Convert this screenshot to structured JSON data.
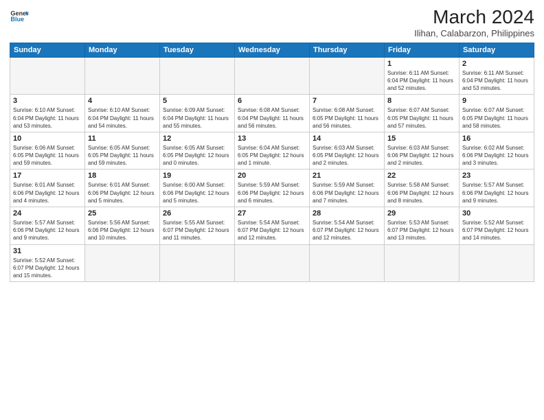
{
  "header": {
    "logo_line1": "General",
    "logo_line2": "Blue",
    "title": "March 2024",
    "subtitle": "Ilihan, Calabarzon, Philippines"
  },
  "weekdays": [
    "Sunday",
    "Monday",
    "Tuesday",
    "Wednesday",
    "Thursday",
    "Friday",
    "Saturday"
  ],
  "weeks": [
    [
      {
        "day": "",
        "info": ""
      },
      {
        "day": "",
        "info": ""
      },
      {
        "day": "",
        "info": ""
      },
      {
        "day": "",
        "info": ""
      },
      {
        "day": "",
        "info": ""
      },
      {
        "day": "1",
        "info": "Sunrise: 6:11 AM\nSunset: 6:04 PM\nDaylight: 11 hours\nand 52 minutes."
      },
      {
        "day": "2",
        "info": "Sunrise: 6:11 AM\nSunset: 6:04 PM\nDaylight: 11 hours\nand 53 minutes."
      }
    ],
    [
      {
        "day": "3",
        "info": "Sunrise: 6:10 AM\nSunset: 6:04 PM\nDaylight: 11 hours\nand 53 minutes."
      },
      {
        "day": "4",
        "info": "Sunrise: 6:10 AM\nSunset: 6:04 PM\nDaylight: 11 hours\nand 54 minutes."
      },
      {
        "day": "5",
        "info": "Sunrise: 6:09 AM\nSunset: 6:04 PM\nDaylight: 11 hours\nand 55 minutes."
      },
      {
        "day": "6",
        "info": "Sunrise: 6:08 AM\nSunset: 6:04 PM\nDaylight: 11 hours\nand 56 minutes."
      },
      {
        "day": "7",
        "info": "Sunrise: 6:08 AM\nSunset: 6:05 PM\nDaylight: 11 hours\nand 56 minutes."
      },
      {
        "day": "8",
        "info": "Sunrise: 6:07 AM\nSunset: 6:05 PM\nDaylight: 11 hours\nand 57 minutes."
      },
      {
        "day": "9",
        "info": "Sunrise: 6:07 AM\nSunset: 6:05 PM\nDaylight: 11 hours\nand 58 minutes."
      }
    ],
    [
      {
        "day": "10",
        "info": "Sunrise: 6:06 AM\nSunset: 6:05 PM\nDaylight: 11 hours\nand 59 minutes."
      },
      {
        "day": "11",
        "info": "Sunrise: 6:05 AM\nSunset: 6:05 PM\nDaylight: 11 hours\nand 59 minutes."
      },
      {
        "day": "12",
        "info": "Sunrise: 6:05 AM\nSunset: 6:05 PM\nDaylight: 12 hours\nand 0 minutes."
      },
      {
        "day": "13",
        "info": "Sunrise: 6:04 AM\nSunset: 6:05 PM\nDaylight: 12 hours\nand 1 minute."
      },
      {
        "day": "14",
        "info": "Sunrise: 6:03 AM\nSunset: 6:05 PM\nDaylight: 12 hours\nand 2 minutes."
      },
      {
        "day": "15",
        "info": "Sunrise: 6:03 AM\nSunset: 6:06 PM\nDaylight: 12 hours\nand 2 minutes."
      },
      {
        "day": "16",
        "info": "Sunrise: 6:02 AM\nSunset: 6:06 PM\nDaylight: 12 hours\nand 3 minutes."
      }
    ],
    [
      {
        "day": "17",
        "info": "Sunrise: 6:01 AM\nSunset: 6:06 PM\nDaylight: 12 hours\nand 4 minutes."
      },
      {
        "day": "18",
        "info": "Sunrise: 6:01 AM\nSunset: 6:06 PM\nDaylight: 12 hours\nand 5 minutes."
      },
      {
        "day": "19",
        "info": "Sunrise: 6:00 AM\nSunset: 6:06 PM\nDaylight: 12 hours\nand 5 minutes."
      },
      {
        "day": "20",
        "info": "Sunrise: 5:59 AM\nSunset: 6:06 PM\nDaylight: 12 hours\nand 6 minutes."
      },
      {
        "day": "21",
        "info": "Sunrise: 5:59 AM\nSunset: 6:06 PM\nDaylight: 12 hours\nand 7 minutes."
      },
      {
        "day": "22",
        "info": "Sunrise: 5:58 AM\nSunset: 6:06 PM\nDaylight: 12 hours\nand 8 minutes."
      },
      {
        "day": "23",
        "info": "Sunrise: 5:57 AM\nSunset: 6:06 PM\nDaylight: 12 hours\nand 9 minutes."
      }
    ],
    [
      {
        "day": "24",
        "info": "Sunrise: 5:57 AM\nSunset: 6:06 PM\nDaylight: 12 hours\nand 9 minutes."
      },
      {
        "day": "25",
        "info": "Sunrise: 5:56 AM\nSunset: 6:06 PM\nDaylight: 12 hours\nand 10 minutes."
      },
      {
        "day": "26",
        "info": "Sunrise: 5:55 AM\nSunset: 6:07 PM\nDaylight: 12 hours\nand 11 minutes."
      },
      {
        "day": "27",
        "info": "Sunrise: 5:54 AM\nSunset: 6:07 PM\nDaylight: 12 hours\nand 12 minutes."
      },
      {
        "day": "28",
        "info": "Sunrise: 5:54 AM\nSunset: 6:07 PM\nDaylight: 12 hours\nand 12 minutes."
      },
      {
        "day": "29",
        "info": "Sunrise: 5:53 AM\nSunset: 6:07 PM\nDaylight: 12 hours\nand 13 minutes."
      },
      {
        "day": "30",
        "info": "Sunrise: 5:52 AM\nSunset: 6:07 PM\nDaylight: 12 hours\nand 14 minutes."
      }
    ],
    [
      {
        "day": "31",
        "info": "Sunrise: 5:52 AM\nSunset: 6:07 PM\nDaylight: 12 hours\nand 15 minutes."
      },
      {
        "day": "",
        "info": ""
      },
      {
        "day": "",
        "info": ""
      },
      {
        "day": "",
        "info": ""
      },
      {
        "day": "",
        "info": ""
      },
      {
        "day": "",
        "info": ""
      },
      {
        "day": "",
        "info": ""
      }
    ]
  ]
}
